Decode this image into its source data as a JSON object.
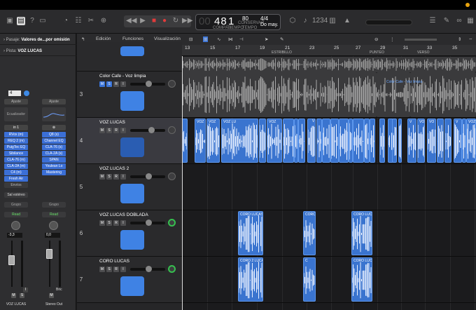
{
  "lcd": {
    "bar": "48",
    "beat": "1",
    "dim": "00",
    "bar_lbl": "COMPÁS",
    "beat_lbl": "TIEMPO",
    "bpm": "80",
    "bpm_lbl": "CONSERVAR",
    "tonal_lbl": "TEMPO",
    "sig": "4/4",
    "key": "Do may."
  },
  "inspector": {
    "region_label": "Pasaje:",
    "region_value": "Valores de...por omisión",
    "track_label": "Pista:",
    "track_value": "VOZ LUCAS",
    "ch1": {
      "label_btn": "Ajuste",
      "eq": "Ecualizador",
      "input": "in 1",
      "plugins": [
        "RVox (m)",
        "REQ 2 (m)",
        "PuigTec EQ",
        "Sibilance",
        "CLA-76 (m)",
        "CLA-2A (m)",
        "C4 (m)",
        "Fresh Air"
      ],
      "sends": "Envíos",
      "output": "Sal estéreo",
      "group": "Grupo",
      "auto": "Read",
      "vol": "-3,3",
      "name": "VOZ LUCAS",
      "num": "4"
    },
    "ch2": {
      "label_btn": "Ajuste",
      "plugins": [
        "Q8 (s)",
        "Channel EQ",
        "CLA-76 (s)",
        "CLA-2A (s)",
        "SPAN",
        "Youlean Lo",
        "Mastering"
      ],
      "group": "Grupo",
      "auto": "Read",
      "vol": "0,0",
      "name": "Stereo Out",
      "bnc": "Bnc"
    }
  },
  "editbar": {
    "edit": "Edición",
    "functions": "Funciones",
    "view": "Visualización"
  },
  "ruler": {
    "numbers": [
      "13",
      "15",
      "17",
      "19",
      "21",
      "23",
      "25",
      "27",
      "29",
      "31",
      "33",
      "35"
    ],
    "markers": [
      "ESTRIBILLO",
      "PUNTEO",
      "VERSO"
    ]
  },
  "tracks": [
    {
      "num": "3",
      "name": "Color Cafe - Voz limpia"
    },
    {
      "num": "4",
      "name": "VOZ LUCAS"
    },
    {
      "num": "5",
      "name": "VOZ LUCAS 2"
    },
    {
      "num": "6",
      "name": "VOZ LUCAS DOBLADA"
    },
    {
      "num": "7",
      "name": "CORO LUCAS"
    }
  ],
  "buttons": {
    "m": "M",
    "s": "S",
    "r": "R",
    "i": "I"
  },
  "regions": {
    "color_cafe": "Color Cafe - Voz limpia",
    "voz": "VOZ",
    "voz_lu": "VOZ LU",
    "voz_lucas": "VOZ LUCAS",
    "v": "V",
    "vo": "VO",
    "coro": "CORO LUCAS",
    "coro2": "CORO 2 LUCA",
    "c": "C"
  }
}
